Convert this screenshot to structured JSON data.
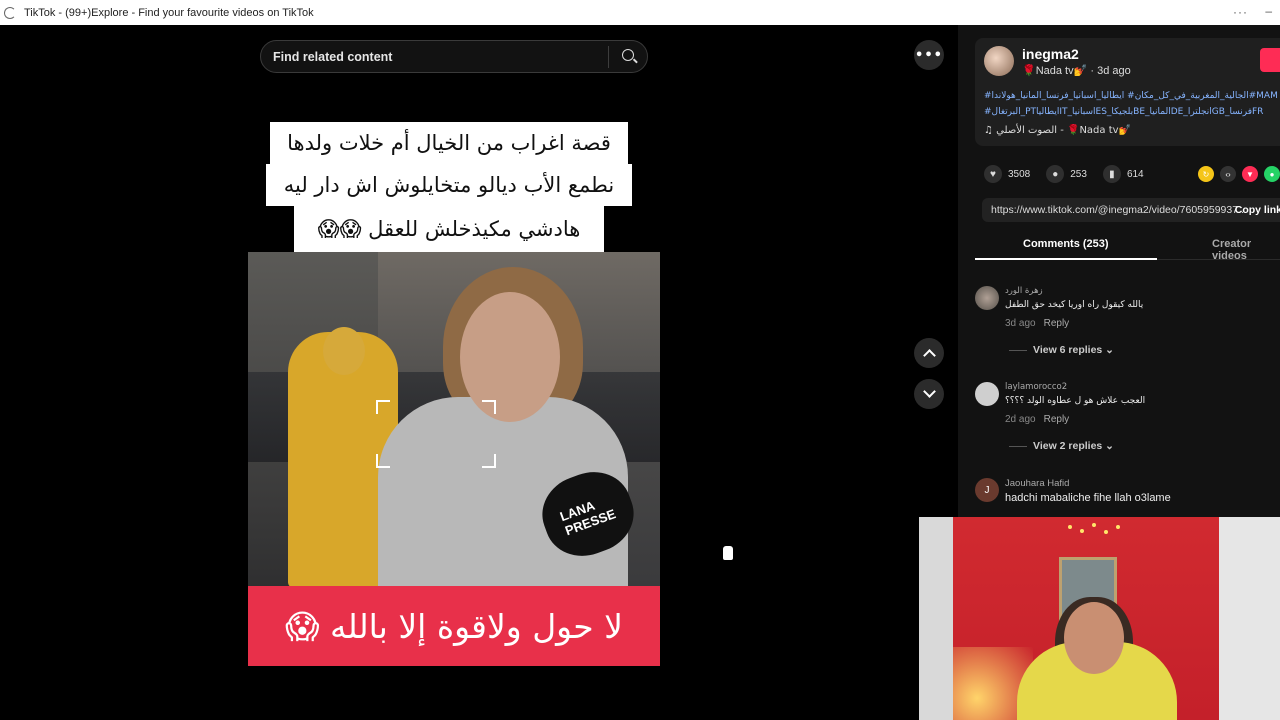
{
  "window": {
    "title": "TikTok - (99+)Explore - Find your favourite videos on TikTok",
    "menu_dots": "···",
    "minimize": "–"
  },
  "search": {
    "placeholder": "Find related content"
  },
  "video": {
    "caption_line1": "قصة اغراب من الخيال أم خلات ولدها",
    "caption_line2": "نطمع الأب ديالو متخايلوش اش دار ليه",
    "caption_line3": "هادشي مكيذخلش للعقل 😱😱",
    "mic_brand": "LANA PRESSE",
    "bottom_banner": "لا حول ولاقوة إلا بالله 😱"
  },
  "nav": {
    "more_label": "•••"
  },
  "author": {
    "username": "inegma2",
    "subtitle": "🌹Nada tv💅 · 3d ago",
    "hashtags_line1": "#الجالية_المغربية_في_كل_مكان# ايطاليا_اسبانيا_فرنسا_المانيا_هولاندا#MAM",
    "hashtags_line2": "#البرتغال_PTايطالياIT_اسبانياES_بلجيكاBE_المانياDE_انجلتراGB_فرنساFR",
    "music": "♫ الصوت الأصلي - 🌹Nada tv💅"
  },
  "stats": {
    "likes": "3508",
    "comments": "253",
    "saves": "614"
  },
  "share": {
    "url": "https://www.tiktok.com/@inegma2/video/7605959937...",
    "copy_label": "Copy link"
  },
  "tabs": [
    {
      "label": "Comments (253)"
    },
    {
      "label": "Creator videos"
    }
  ],
  "comments": [
    {
      "name": "زهرة الورد",
      "text": "يالله كيقول راه اوريا كيخد حق الطفل",
      "time": "3d ago",
      "reply": "Reply",
      "replies": "View 6 replies ⌄"
    },
    {
      "name": "laylamorocco2",
      "text": "العجب علاش هو ل عطاوه الولد ؟؟؟؟",
      "time": "2d ago",
      "reply": "Reply",
      "replies": "View 2 replies ⌄"
    },
    {
      "name": "Jaouhara Hafid",
      "text": "hadchi mabaliche fihe llah o3lame",
      "avatar_letter": "J"
    }
  ],
  "colors": {
    "tiktok_red": "#fe2c55",
    "banner_red": "#e8304a",
    "hashtag_blue": "#86b4ff",
    "bg": "#000000",
    "panel": "#121212"
  }
}
